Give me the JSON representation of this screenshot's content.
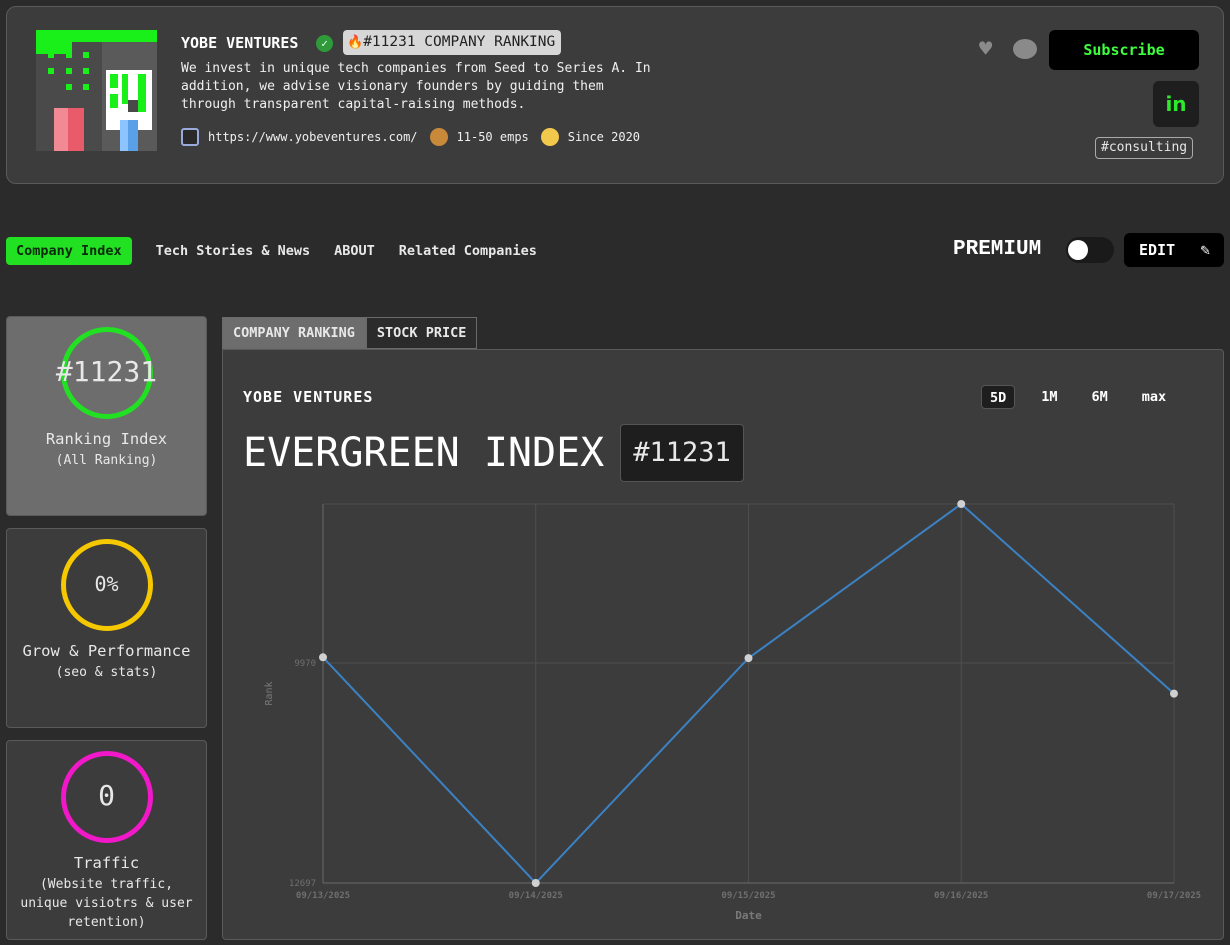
{
  "header": {
    "company_name": "YOBE VENTURES",
    "rank_badge": "#11231 COMPANY RANKING",
    "description": "We invest in unique tech companies from Seed to Series A. In addition, we advise visionary founders by guiding them through transparent capital-raising methods.",
    "website": "https://www.yobeventures.com/",
    "employees": "11-50 emps",
    "since": "Since 2020",
    "subscribe_label": "Subscribe",
    "linkedin_label": "in",
    "tag": "#consulting"
  },
  "nav": {
    "items": [
      "Company Index",
      "Tech Stories & News",
      "ABOUT",
      "Related Companies"
    ],
    "premium_label": "PREMIUM",
    "edit_label": "EDIT"
  },
  "cards": [
    {
      "value": "#11231",
      "title": "Ranking Index",
      "subtitle": "(All Ranking)",
      "color": "#22e022"
    },
    {
      "value": "0%",
      "title": "Grow & Performance",
      "subtitle": "(seo & stats)",
      "color": "#f5c800"
    },
    {
      "value": "0",
      "title": "Traffic",
      "subtitle": "(Website traffic, unique visiotrs & user retention)",
      "color": "#f018c8"
    }
  ],
  "panel": {
    "tabs": [
      "COMPANY RANKING",
      "STOCK PRICE"
    ],
    "company_name": "YOBE VENTURES",
    "ranges": [
      "5D",
      "1M",
      "6M",
      "max"
    ],
    "selected_range": "5D",
    "index_title": "EVERGREEN INDEX",
    "index_value": "#11231"
  },
  "chart_data": {
    "type": "line",
    "x": [
      "09/13/2025",
      "09/14/2025",
      "09/15/2025",
      "09/16/2025",
      "09/17/2025"
    ],
    "values": [
      9900,
      12697,
      9910,
      8000,
      10350
    ],
    "xlabel": "Date",
    "ylabel": "Rank",
    "y_ticks": [
      "9970",
      "12697"
    ],
    "y_tick_values": [
      9970,
      12697
    ],
    "ylim": [
      8000,
      12697
    ],
    "y_reversed": true,
    "line_color": "#3b82c4",
    "point_color": "#d0d0d0",
    "grid": true
  }
}
